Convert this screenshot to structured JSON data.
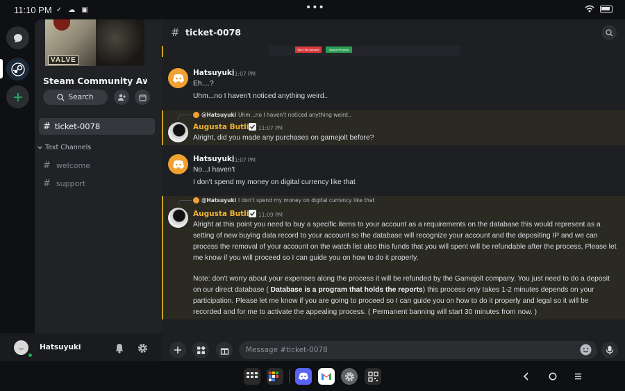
{
  "statusbar": {
    "time": "11:10 PM",
    "icons": "✓ ☁ ▣"
  },
  "server": {
    "name": "Steam Community Awa...",
    "banner_text": "VALVE",
    "search_label": "Search"
  },
  "channels": {
    "active": "ticket-0078",
    "category": "Text Channels",
    "list": [
      "welcome",
      "support"
    ]
  },
  "user": {
    "name": "Hatsuyuki"
  },
  "chat": {
    "channel_title": "ticket-0078",
    "embed_buttons": [
      "Ban This Account",
      "Appeal Process"
    ],
    "messages": [
      {
        "author": "Hatsuyuki",
        "time": "11:07 PM",
        "lines": [
          "Eh....?",
          "Uhm...no I haven't noticed anything weird.."
        ]
      },
      {
        "reply_to": "@Hatsuyuki",
        "reply_text": "Uhm...no I haven't noticed anything weird..",
        "author": "Augusta Butlin",
        "time": "11:07 PM",
        "lines": [
          "Alright, did you made any purchases on gamejolt before?"
        ]
      },
      {
        "author": "Hatsuyuki",
        "time": "11:07 PM",
        "lines": [
          "No...I haven't",
          "I don't spend my money on digital currency like that"
        ]
      },
      {
        "reply_to": "@Hatsuyuki",
        "reply_text": "I don't spend my money on digital currency like that",
        "author": "Augusta Butlin",
        "time": "11:09 PM",
        "paragraph1": "Alright at this point you need to buy a specific items to your account as a requirements on the database this would represent as a setting of new buying data record to your account so the database will recognize your account and the depositing IP and we can process the removal of your account on the watch list also this funds that you will spent will be refundable after the process, Please let me know if you will proceed so I can guide you on how to do it properly.",
        "paragraph2_a": "Note: don't worry about your expenses along the process it will be refunded by the Gamejolt company. You just need to do a deposit on our direct database (",
        "paragraph2_bold": "Database is a program that holds the reports",
        "paragraph2_b": ")  this process only takes 1-2 minutes depends on your participation. Please let me know if you are going to proceed so I can guide you on how to do it properly and legal so it will be recorded and for me to activate the appealing process. ( Permanent banning will start 30 minutes from now.  )"
      }
    ],
    "composer_placeholder": "Message #ticket-0078"
  },
  "colors": {
    "accent_gold": "#c9a227",
    "author_gold": "#f0b232",
    "discord_orange": "#f0a132",
    "online_green": "#23a55a"
  },
  "taskbar": {
    "apps": [
      "apps-grid-icon",
      "multi-app-icon",
      "discord-icon",
      "gmail-icon",
      "settings-icon",
      "qr-scanner-icon"
    ]
  }
}
